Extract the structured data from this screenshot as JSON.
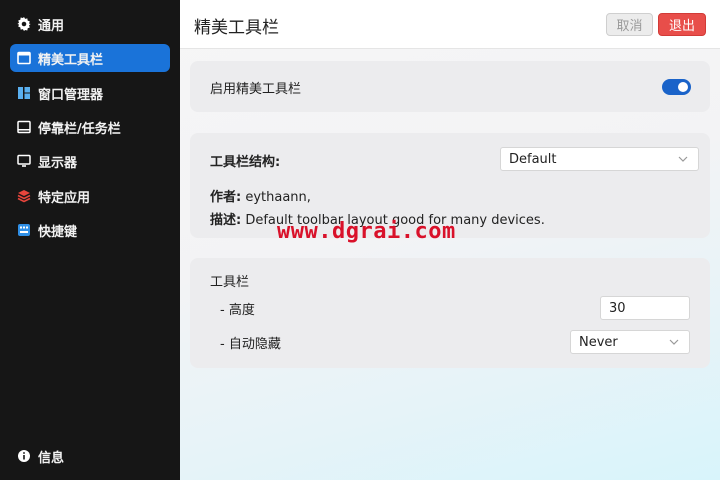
{
  "sidebar": {
    "items": [
      {
        "label": "通用",
        "icon": "gear-icon"
      },
      {
        "label": "精美工具栏",
        "icon": "window-icon"
      },
      {
        "label": "窗口管理器",
        "icon": "layout-icon"
      },
      {
        "label": "停靠栏/任务栏",
        "icon": "dock-icon"
      },
      {
        "label": "显示器",
        "icon": "monitor-icon"
      },
      {
        "label": "特定应用",
        "icon": "layers-icon"
      },
      {
        "label": "快捷键",
        "icon": "keyboard-icon"
      }
    ],
    "info": {
      "label": "信息",
      "icon": "info-icon"
    }
  },
  "header": {
    "title": "精美工具栏",
    "cancel_label": "取消",
    "exit_label": "退出"
  },
  "enable_card": {
    "label": "启用精美工具栏",
    "enabled": true
  },
  "structure_card": {
    "label": "工具栏结构:",
    "selected": "Default",
    "author_label": "作者:",
    "author_value": "eythaann,",
    "desc_label": "描述:",
    "desc_value": "Default toolbar layout good for many devices."
  },
  "toolbar_card": {
    "title": "工具栏",
    "height_label": "- 高度",
    "height_value": "30",
    "autohide_label": "- 自动隐藏",
    "autohide_value": "Never"
  },
  "watermark": "www.dgrai.com",
  "colors": {
    "accent": "#1a73d9",
    "exit": "#e84e4a",
    "toggle": "#1a63c9"
  }
}
